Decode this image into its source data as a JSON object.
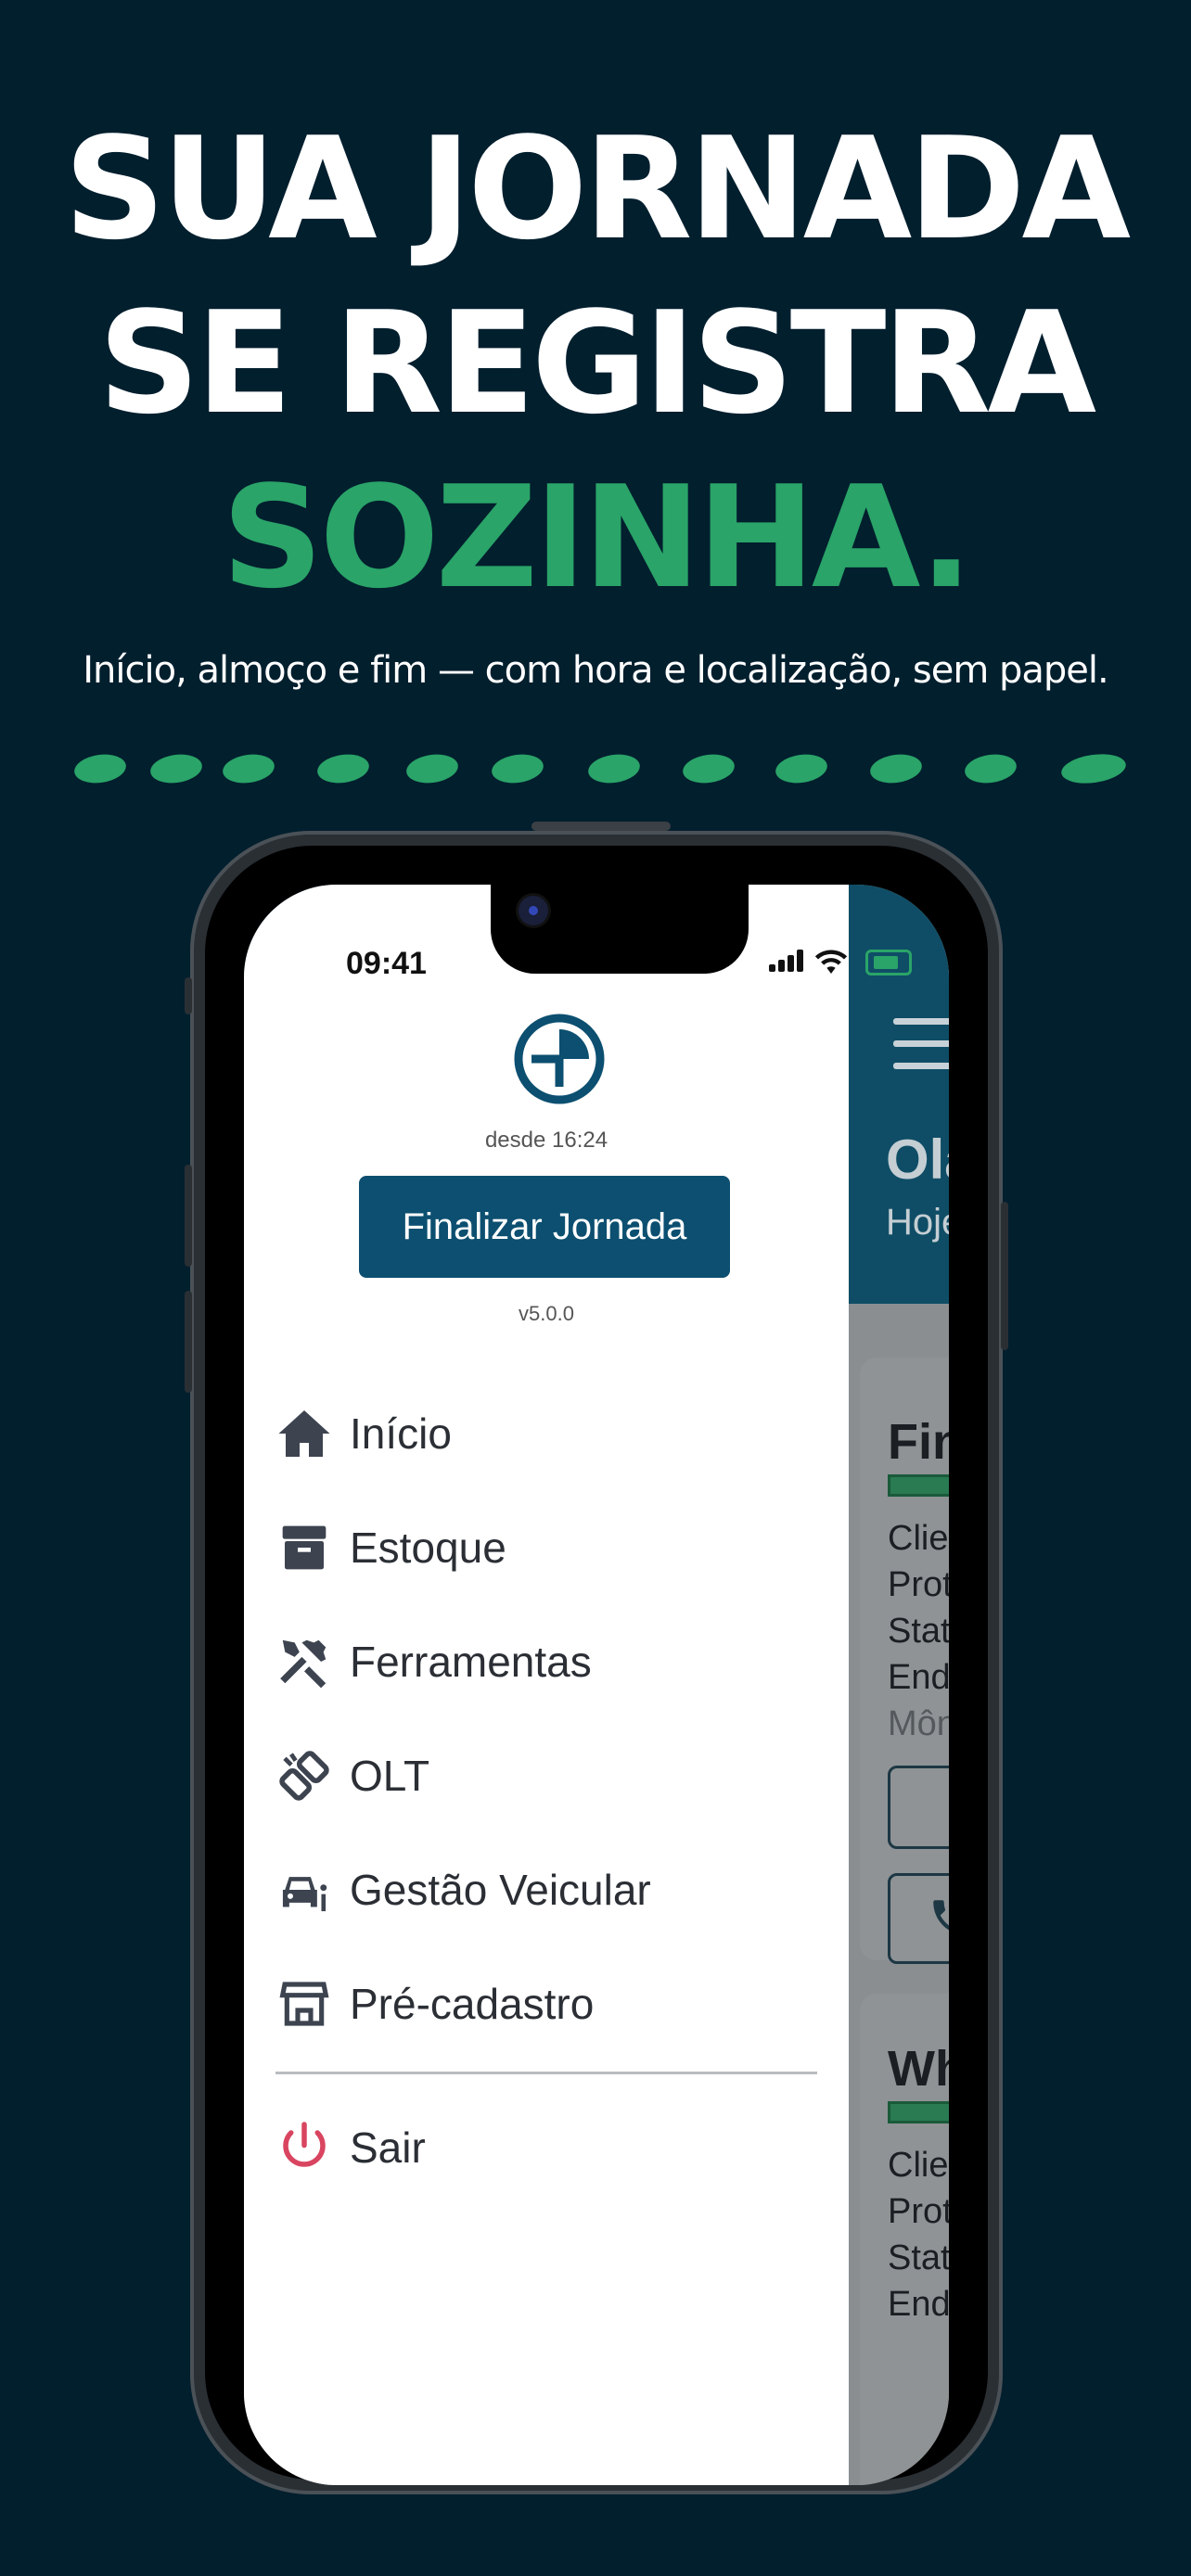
{
  "hero": {
    "line1": "SUA JORNADA",
    "line2": "SE REGISTRA",
    "line3": "SOZINHA.",
    "subtitle": "Início, almoço e fim — com hora e localização, sem papel."
  },
  "colors": {
    "background": "#021f2e",
    "accent": "#2aa468",
    "primary": "#0c4f70",
    "danger": "#d94560"
  },
  "status_bar": {
    "time": "09:41"
  },
  "drawer": {
    "since": "desde 16:24",
    "finish_button": "Finalizar Jornada",
    "version": "v5.0.0",
    "menu": [
      {
        "label": "Início",
        "icon": "home-icon"
      },
      {
        "label": "Estoque",
        "icon": "archive-box-icon"
      },
      {
        "label": "Ferramentas",
        "icon": "tools-icon"
      },
      {
        "label": "OLT",
        "icon": "cable-plug-icon"
      },
      {
        "label": "Gestão Veicular",
        "icon": "car-info-icon"
      },
      {
        "label": "Pré-cadastro",
        "icon": "store-icon"
      }
    ],
    "logout": {
      "label": "Sair",
      "icon": "power-icon"
    }
  },
  "background_app": {
    "greeting": "Olá",
    "today": "Hoje v",
    "cards": [
      {
        "title": "Fina",
        "lines": [
          "Clien",
          "Proto",
          "Statu",
          "Ende"
        ],
        "extra": "Mônic"
      },
      {
        "title": "Wha",
        "lines": [
          "Clien",
          "Proto",
          "Statu",
          "Ende"
        ]
      }
    ]
  }
}
